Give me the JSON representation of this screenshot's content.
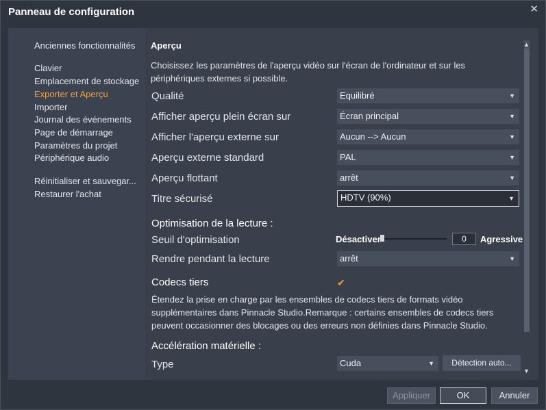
{
  "window": {
    "title": "Panneau de configuration",
    "close_glyph": "✕"
  },
  "sidebar": {
    "items": [
      {
        "label": "Anciennes fonctionnalités"
      },
      {
        "label": "Clavier"
      },
      {
        "label": "Emplacement de stockage"
      },
      {
        "label": "Exporter et Aperçu",
        "active": true
      },
      {
        "label": "Importer"
      },
      {
        "label": "Journal des événements"
      },
      {
        "label": "Page de démarrage"
      },
      {
        "label": "Paramètres du projet"
      },
      {
        "label": "Périphérique audio"
      },
      {
        "label": "Réinitialiser et sauvegar..."
      },
      {
        "label": "Restaurer l'achat"
      }
    ]
  },
  "preview": {
    "section_title": "Aperçu",
    "description": "Choisissez les paramètres de l'aperçu vidéo sur l'écran de l'ordinateur et sur les périphériques externes si possible.",
    "quality": {
      "label": "Qualité",
      "value": "Equilibré"
    },
    "fullscreen": {
      "label": "Afficher aperçu plein écran sur",
      "value": "Écran principal"
    },
    "external": {
      "label": "Afficher l'aperçu externe sur",
      "value": "Aucun --> Aucun"
    },
    "external_standard": {
      "label": "Aperçu externe standard",
      "value": "PAL"
    },
    "floating": {
      "label": "Aperçu flottant",
      "value": "arrêt"
    },
    "safe_title": {
      "label": "Titre sécurisé",
      "value": "HDTV (90%)"
    }
  },
  "playback": {
    "heading": "Optimisation de la lecture :",
    "threshold": {
      "label": "Seuil d'optimisation",
      "min_label": "Désactiver",
      "max_label": "Agressive",
      "value": "0",
      "level": 0
    },
    "render": {
      "label": "Rendre pendant la lecture",
      "value": "arrêt"
    }
  },
  "codecs": {
    "heading": "Codecs tiers",
    "checked": true,
    "check_glyph": "✔",
    "description": "Étendez la prise en charge par les ensembles de codecs tiers de formats vidéo supplémentaires dans Pinnacle Studio.Remarque : certains ensembles de codecs tiers peuvent occasionner des blocages ou des erreurs non définies dans Pinnacle Studio."
  },
  "hardware": {
    "heading": "Accélération matérielle :",
    "type": {
      "label": "Type",
      "value": "Cuda"
    },
    "detect_label": "Détection auto..."
  },
  "footer": {
    "apply_label": "Appliquer",
    "ok_label": "OK",
    "cancel_label": "Annuler"
  },
  "icons": {
    "dropdown": "chevron-down-icon",
    "scroll_up": "scroll-up-icon",
    "scroll_down": "scroll-down-icon",
    "dropdown_glyph": "▼",
    "up_glyph": "▲",
    "down_glyph": "▼"
  },
  "colors": {
    "accent": "#f5a23a",
    "panel": "#3b4250",
    "background": "#2f353f"
  }
}
